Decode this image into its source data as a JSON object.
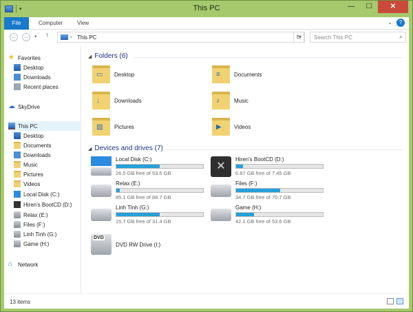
{
  "window": {
    "title": "This PC"
  },
  "ribbon": {
    "tabs": [
      "File",
      "Computer",
      "View"
    ]
  },
  "nav": {
    "path": "This PC",
    "search_placeholder": "Search This PC"
  },
  "sidebar": {
    "favorites": "Favorites",
    "fav_items": [
      "Desktop",
      "Downloads",
      "Recent places"
    ],
    "skydrive": "SkyDrive",
    "thispc": "This PC",
    "pc_items": [
      "Desktop",
      "Documents",
      "Downloads",
      "Music",
      "Pictures",
      "Videos",
      "Local Disk (C:)",
      "Hiren's BootCD (D:)",
      "Relax (E:)",
      "Files (F:)",
      "Linh Tinh (G:)",
      "Game (H:)"
    ],
    "network": "Network"
  },
  "folders": {
    "header": "Folders (6)",
    "items": [
      "Desktop",
      "Documents",
      "Downloads",
      "Music",
      "Pictures",
      "Videos"
    ]
  },
  "drives": {
    "header": "Devices and drives (7)",
    "items": [
      {
        "name": "Local Disk (C:)",
        "free": "26.5 GB free of 53.5 GB",
        "used_pct": 50
      },
      {
        "name": "Hiren's BootCD (D:)",
        "free": "6.87 GB free of 7.45 GB",
        "used_pct": 8
      },
      {
        "name": "Relax (E:)",
        "free": "85.1 GB free of 88.7 GB",
        "used_pct": 4
      },
      {
        "name": "Files (F:)",
        "free": "34.7 GB free of 70.7 GB",
        "used_pct": 51
      },
      {
        "name": "Linh Tinh (G:)",
        "free": "15.7 GB free of 31.4 GB",
        "used_pct": 50
      },
      {
        "name": "Game (H:)",
        "free": "42.1 GB free of 53.6 GB",
        "used_pct": 21
      },
      {
        "name": "DVD RW Drive (I:)"
      }
    ]
  },
  "status": {
    "count": "13 items"
  },
  "colors": {
    "frame": "#a6c96d",
    "accent": "#1979ca",
    "bar": "#26a0da",
    "group_header": "#1e3287"
  }
}
